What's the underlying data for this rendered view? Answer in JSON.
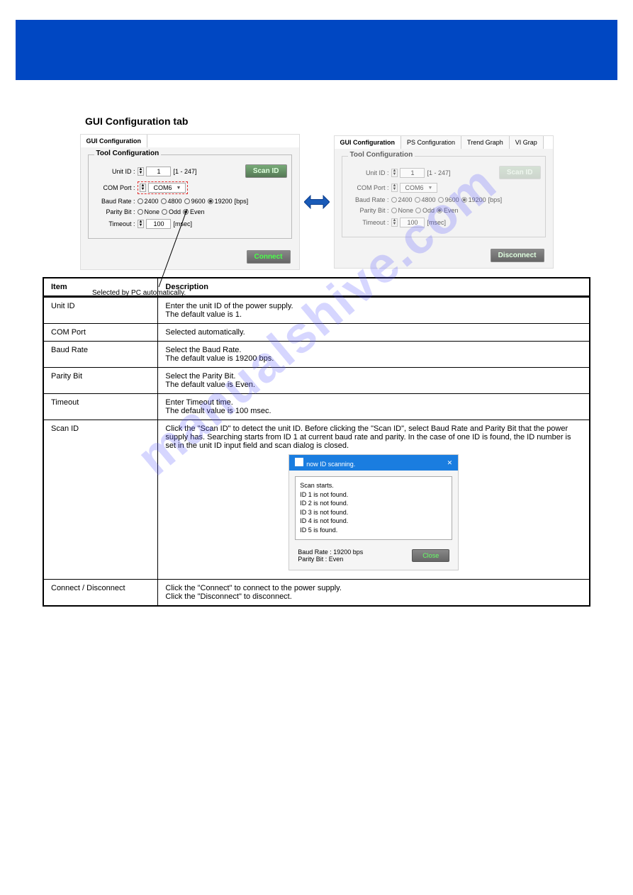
{
  "watermark": "manualshive.com",
  "section_heading": "GUI Configuration tab",
  "left_panel": {
    "tabs": [
      "GUI Configuration"
    ],
    "group_title": "Tool Configuration",
    "unit_id": {
      "label": "Unit ID :",
      "value": "1",
      "range": "[1 - 247]"
    },
    "com_port": {
      "label": "COM Port :",
      "value": "COM6"
    },
    "baud": {
      "label": "Baud Rate :",
      "options": [
        "2400",
        "4800",
        "9600",
        "19200"
      ],
      "selected": "19200",
      "unit": "[bps]"
    },
    "parity": {
      "label": "Parity Bit :",
      "options": [
        "None",
        "Odd",
        "Even"
      ],
      "selected": "Even"
    },
    "timeout": {
      "label": "Timeout :",
      "value": "100",
      "unit": "[msec]"
    },
    "scan_btn": "Scan ID",
    "connect_btn": "Connect",
    "marker_note": "Selected by PC automatically."
  },
  "right_panel": {
    "tabs": [
      "GUI Configuration",
      "PS Configuration",
      "Trend Graph",
      "VI Grap"
    ],
    "group_title": "Tool Configuration",
    "unit_id": {
      "label": "Unit ID :",
      "value": "1",
      "range": "[1 - 247]"
    },
    "com_port": {
      "label": "COM Port :",
      "value": "COM6"
    },
    "baud": {
      "label": "Baud Rate :",
      "options": [
        "2400",
        "4800",
        "9600",
        "19200"
      ],
      "selected": "19200",
      "unit": "[bps]"
    },
    "parity": {
      "label": "Parity Bit :",
      "options": [
        "None",
        "Odd",
        "Even"
      ],
      "selected": "Even"
    },
    "timeout": {
      "label": "Timeout :",
      "value": "100",
      "unit": "[msec]"
    },
    "scan_btn": "Scan ID",
    "disconnect_btn": "Disconnect"
  },
  "table": {
    "header": [
      "Item",
      "Description"
    ],
    "rows": [
      {
        "item": "Unit ID",
        "desc": "Enter the unit ID of the power supply.\nThe default value is 1."
      },
      {
        "item": "COM Port",
        "desc": "Selected automatically."
      },
      {
        "item": "Baud Rate",
        "desc": "Select the Baud Rate.\nThe default value is 19200 bps."
      },
      {
        "item": "Parity Bit",
        "desc": "Select the Parity Bit.\nThe default value is Even."
      },
      {
        "item": "Timeout",
        "desc": "Enter Timeout time.\nThe default value is 100 msec."
      },
      {
        "item": "Scan ID",
        "desc_top": "Click the \"Scan ID\" to detect the unit ID. Before clicking the \"Scan ID\", select Baud Rate and Parity Bit that the power supply has. Searching starts from ID 1 at current baud rate and parity. In the case of one ID is found, the ID number is set in the unit ID input field and scan dialog is closed.",
        "has_dialog": true
      },
      {
        "item": "Connect / Disconnect",
        "desc": "Click the \"Connect\" to connect to the power supply.\nClick the \"Disconnect\" to disconnect."
      }
    ]
  },
  "scan_dialog": {
    "title": "now ID scanning.",
    "lines": [
      "Scan starts.",
      "ID 1 is not found.",
      "ID 2 is not found.",
      "ID 3 is not found.",
      "ID 4 is not found.",
      "ID 5 is found."
    ],
    "baud_label": "Baud Rate :",
    "baud_value": "19200",
    "baud_unit": "bps",
    "parity_label": "Parity Bit :",
    "parity_value": "Even",
    "close_btn": "Close"
  }
}
